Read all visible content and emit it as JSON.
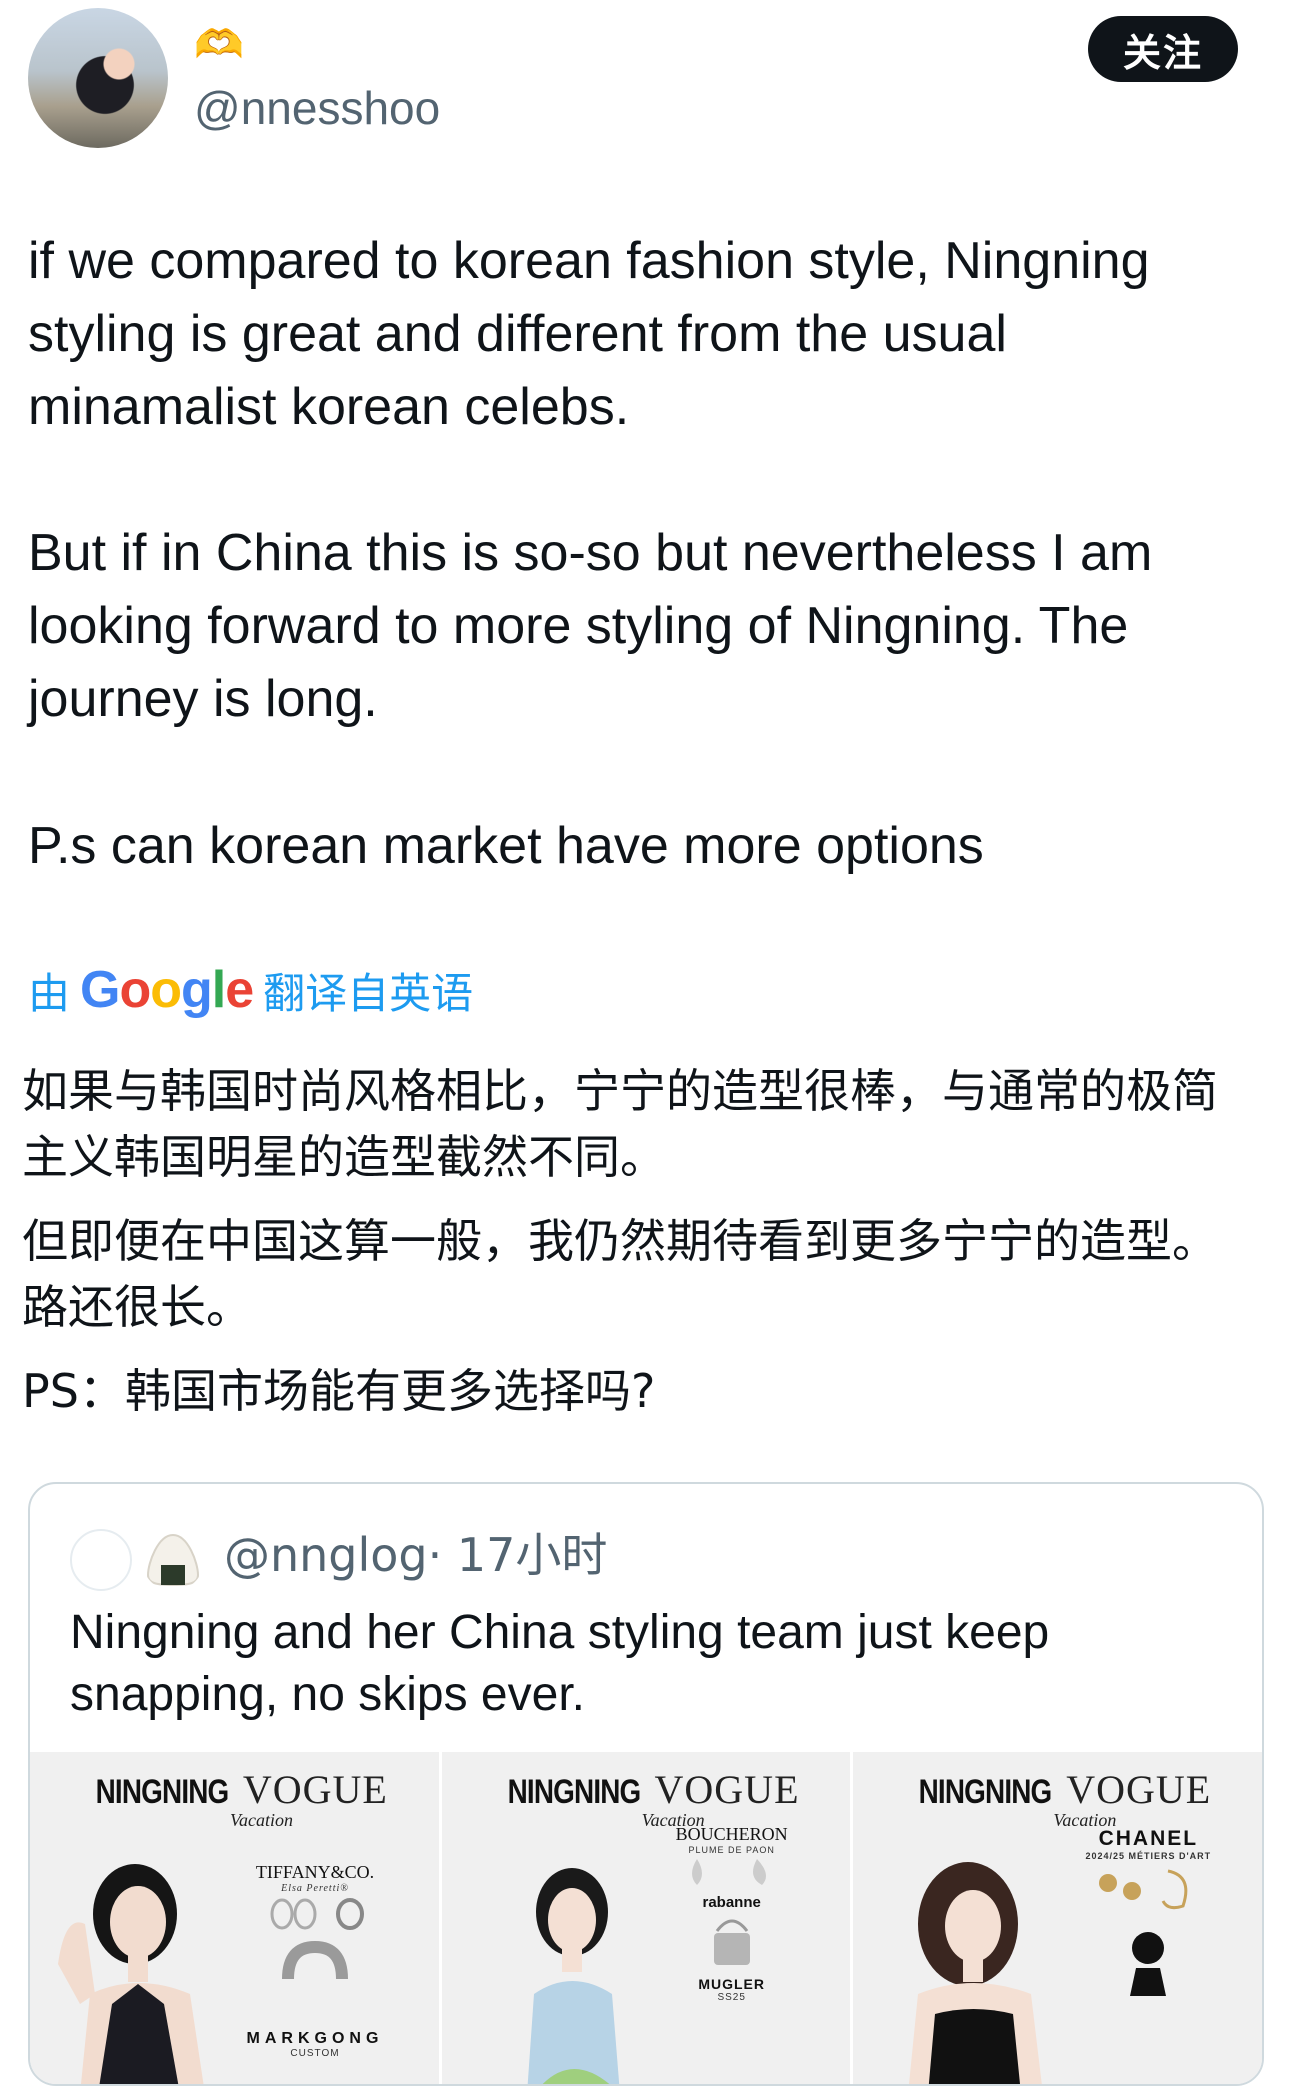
{
  "author": {
    "emoji": "🫶",
    "handle": "@nnesshoo"
  },
  "follow_label": "关注",
  "tweet": {
    "p1": "if we compared to korean fashion style, Ningning styling is great and different from the usual minamalist korean celebs.",
    "p2": "But if in China this is so-so but nevertheless I am looking forward to more styling of Ningning. The journey is long.",
    "p3": "P.s can korean market have more options"
  },
  "translation": {
    "prefix": "由",
    "provider": "Google",
    "suffix": "翻译自英语",
    "zh1": "如果与韩国时尚风格相比，宁宁的造型很棒，与通常的极简主义韩国明星的造型截然不同。",
    "zh2": "但即便在中国这算一般，我仍然期待看到更多宁宁的造型。路还很长。",
    "zh3": "PS：韩国市场能有更多选择吗?"
  },
  "quote": {
    "handle": "@nnglog",
    "time": "· 17小时",
    "text": "Ningning and her China styling team just keep snapping, no skips ever.",
    "panels": [
      {
        "title": "NINGNING",
        "magazine": "VOGUE",
        "sub": "Vacation",
        "brand1": "TIFFANY&CO.",
        "brand1_sub": "Elsa Peretti®",
        "brand2": "MARKGONG",
        "brand2_sub": "CUSTOM",
        "dress_color": "#1b1b22"
      },
      {
        "title": "NINGNING",
        "magazine": "VOGUE",
        "sub": "Vacation",
        "brand1": "BOUCHERON",
        "brand1_sub": "PLUME DE PAON",
        "brand2": "rabanne",
        "brand3": "MUGLER",
        "brand3_sub": "SS25",
        "dress_color": "#b7d3e6"
      },
      {
        "title": "NINGNING",
        "magazine": "VOGUE",
        "sub": "Vacation",
        "brand1": "CHANEL",
        "brand1_sub": "2024/25 MÉTIERS D'ART",
        "dress_color": "#111111"
      }
    ]
  }
}
